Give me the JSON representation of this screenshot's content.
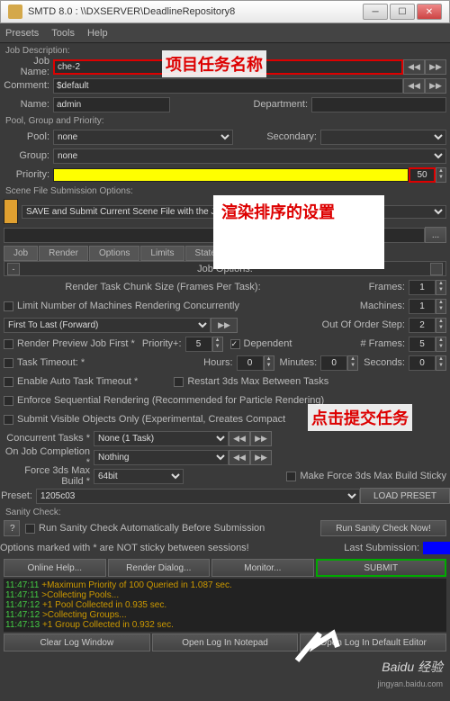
{
  "window": {
    "title": "SMTD 8.0 : \\\\DXSERVER\\DeadlineRepository8"
  },
  "menus": [
    "Presets",
    "Tools",
    "Help"
  ],
  "jobDesc": {
    "title": "Job Description:",
    "jobName": {
      "label": "Job Name:",
      "value": "che-2"
    },
    "comment": {
      "label": "Comment:",
      "value": "$default"
    },
    "name": {
      "label": "Name:",
      "value": "admin"
    },
    "dept": {
      "label": "Department:",
      "value": ""
    }
  },
  "poolGroup": {
    "title": "Pool, Group and Priority:",
    "pool": {
      "label": "Pool:",
      "value": "none"
    },
    "secondary": {
      "label": "Secondary:",
      "value": ""
    },
    "group": {
      "label": "Group:",
      "value": "none"
    },
    "priority": {
      "label": "Priority:",
      "value": "50"
    }
  },
  "sceneFile": {
    "title": "Scene File Submission Options:",
    "option": "SAVE and Submit Current Scene File with the Job to the REPOSITORY *"
  },
  "tabs": [
    "Job",
    "Render",
    "Options",
    "Limits",
    "StateSets"
  ],
  "jobOpts": {
    "header": "Job Options:",
    "chunkSize": "Render Task Chunk Size (Frames Per Task):",
    "frames": "Frames:",
    "framesVal": "1",
    "limitMachines": "Limit Number of Machines Rendering Concurrently",
    "machines": "Machines:",
    "machinesVal": "1",
    "orderSelect": "First To Last (Forward)",
    "outOfOrder": "Out Of Order Step:",
    "outOfOrderVal": "2",
    "renderPreview": "Render Preview Job First *",
    "priorityPlus": "Priority+:",
    "priorityPlusVal": "5",
    "dependent": "Dependent",
    "hashFrames": "# Frames:",
    "hashFramesVal": "5",
    "taskTimeout": "Task Timeout: *",
    "hours": "Hours:",
    "hoursVal": "0",
    "minutes": "Minutes:",
    "minutesVal": "0",
    "seconds": "Seconds:",
    "secondsVal": "0",
    "enableAuto": "Enable Auto Task Timeout *",
    "restart3ds": "Restart 3ds Max Between Tasks",
    "enforceSeq": "Enforce Sequential Rendering (Recommended for Particle Rendering)",
    "submitVisible": "Submit Visible Objects Only (Experimental, Creates Compact",
    "concurrent": "Concurrent Tasks *",
    "concurrentVal": "None (1 Task)",
    "onComplete": "On Job Completion *",
    "onCompleteVal": "Nothing",
    "forceBuild": "Force 3ds Max Build *",
    "forceBuildVal": "64bit",
    "makeSticky": "Make Force 3ds Max Build Sticky"
  },
  "preset": {
    "label": "Preset:",
    "value": "1205c03",
    "loadBtn": "LOAD PRESET"
  },
  "sanity": {
    "title": "Sanity Check:",
    "auto": "Run Sanity Check Automatically Before Submission",
    "runBtn": "Run Sanity Check Now!"
  },
  "footer": {
    "note": "Options marked with * are NOT sticky between sessions!",
    "lastSub": "Last Submission:"
  },
  "mainBtns": {
    "help": "Online Help...",
    "dialog": "Render Dialog...",
    "monitor": "Monitor...",
    "submit": "SUBMIT"
  },
  "log": [
    {
      "t": "11:47:11",
      "m": "+Maximum Priority of 100 Queried in 1.087 sec."
    },
    {
      "t": "11:47:11",
      "m": ">Collecting Pools..."
    },
    {
      "t": "11:47:12",
      "m": "+1 Pool Collected in 0.935 sec."
    },
    {
      "t": "11:47:12",
      "m": ">Collecting Groups..."
    },
    {
      "t": "11:47:13",
      "m": "+1 Group Collected in 0.932 sec."
    }
  ],
  "bottomBtns": {
    "clear": "Clear Log Window",
    "notepad": "Open Log In Notepad",
    "editor": "Open Log In Default Editor"
  },
  "annotations": {
    "a1": "项目任务名称",
    "a2": "渲染排序的设置",
    "a3": "点击提交任务"
  },
  "watermark": {
    "main": "Baidu 经验",
    "sub": "jingyan.baidu.com"
  }
}
